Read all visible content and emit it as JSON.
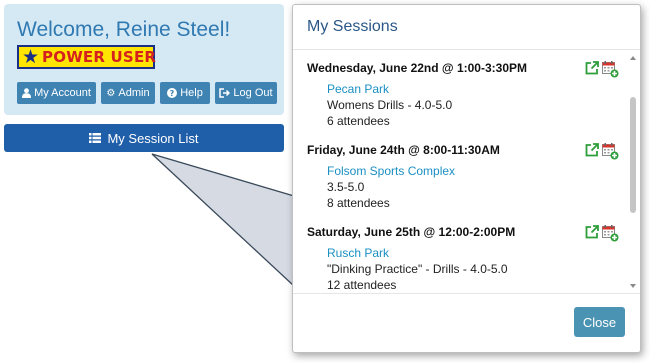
{
  "welcome": {
    "title": "Welcome, Reine Steel!",
    "badge_text": "POWER USER",
    "badge_icon": "star-icon"
  },
  "nav_buttons": [
    {
      "label": "My Account",
      "icon": "user-icon"
    },
    {
      "label": "Admin",
      "icon": "gear-icon"
    },
    {
      "label": "Help",
      "icon": "question-circle-icon"
    },
    {
      "label": "Log Out",
      "icon": "logout-icon"
    }
  ],
  "session_list_button": {
    "label": "My Session List",
    "icon": "list-icon"
  },
  "modal": {
    "title": "My Sessions",
    "close_label": "Close",
    "sessions": [
      {
        "date": "Wednesday, June 22nd @ 1:00-3:30PM",
        "location": "Pecan Park",
        "description": "Womens Drills - 4.0-5.0",
        "attendees": "6 attendees"
      },
      {
        "date": "Friday, June 24th @ 8:00-11:30AM",
        "location": "Folsom Sports Complex",
        "description": "3.5-5.0",
        "attendees": "8 attendees"
      },
      {
        "date": "Saturday, June 25th @ 12:00-2:00PM",
        "location": "Rusch Park",
        "description": "\"Dinking Practice\" - Drills - 4.0-5.0",
        "attendees": "12 attendees"
      }
    ]
  },
  "colors": {
    "accent": "#1f5ea8",
    "button_blue": "#3f83b3",
    "link": "#1a8fc2",
    "panel_bg": "#d5e9f5",
    "badge_yellow": "#ffe500",
    "badge_red": "#d42020",
    "icon_green": "#2e9e3a"
  }
}
